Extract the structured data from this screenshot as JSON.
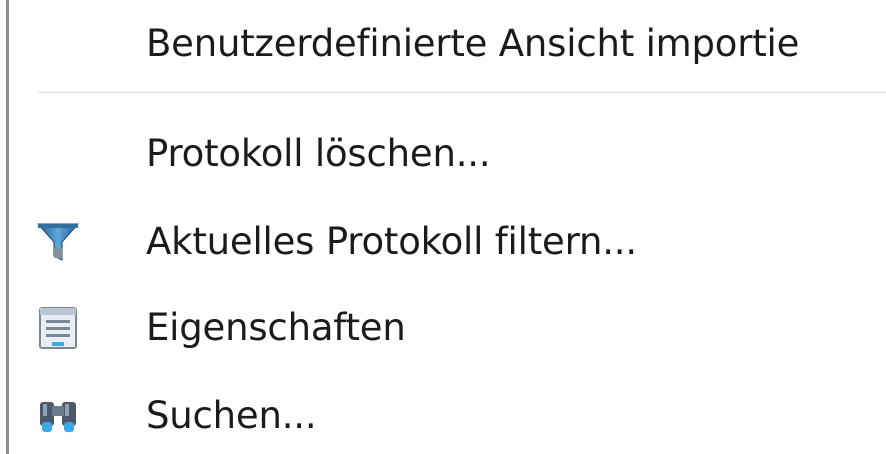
{
  "menu": {
    "items": [
      {
        "label": "Benutzerdefinierte Ansicht importie",
        "icon": ""
      },
      {
        "label": "Protokoll löschen...",
        "icon": ""
      },
      {
        "label": "Aktuelles Protokoll filtern...",
        "icon": "filter-funnel-icon"
      },
      {
        "label": "Eigenschaften",
        "icon": "properties-window-icon"
      },
      {
        "label": "Suchen...",
        "icon": "binoculars-icon"
      }
    ]
  },
  "colors": {
    "background": "#ffffff",
    "text": "#1b1b1b",
    "left_border": "#8a8a8a",
    "separator": "#dcdcdc",
    "icon_blue": "#2f6fa3"
  }
}
